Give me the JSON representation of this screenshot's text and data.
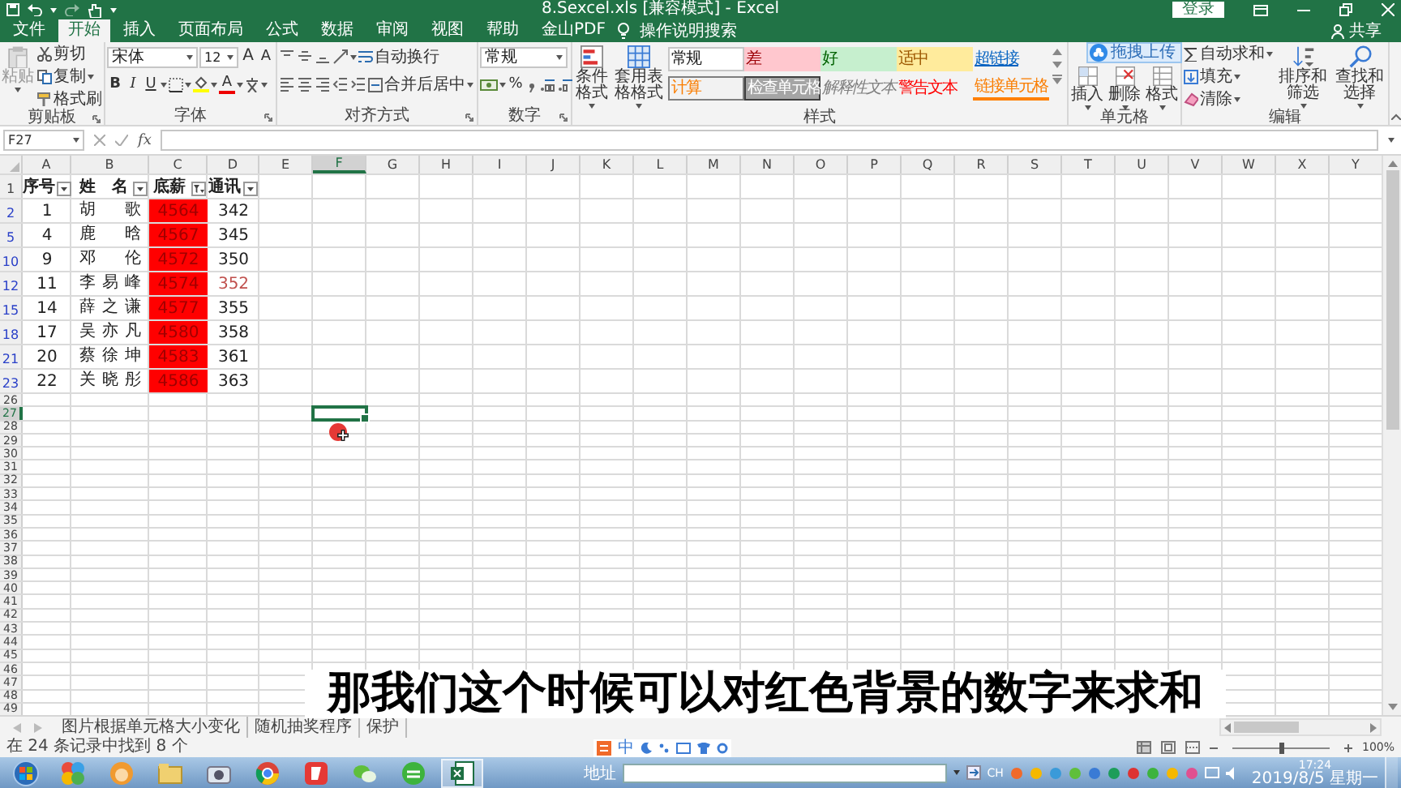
{
  "window": {
    "title": "8.Sexcel.xls [兼容模式] - Excel",
    "sign_in": "登录"
  },
  "menu_tabs": [
    {
      "label": "文件",
      "selected": false
    },
    {
      "label": "开始",
      "selected": true
    },
    {
      "label": "插入",
      "selected": false
    },
    {
      "label": "页面布局",
      "selected": false
    },
    {
      "label": "公式",
      "selected": false
    },
    {
      "label": "数据",
      "selected": false
    },
    {
      "label": "审阅",
      "selected": false
    },
    {
      "label": "视图",
      "selected": false
    },
    {
      "label": "帮助",
      "selected": false
    },
    {
      "label": "金山PDF",
      "selected": false
    }
  ],
  "tell_me": "操作说明搜索",
  "share": "共享",
  "ribbon": [
    {
      "kind": "clipboard",
      "label": "剪贴板",
      "paste": {
        "text": "粘贴",
        "disabled": true
      },
      "commands": [
        "剪切",
        "复制",
        "格式刷"
      ]
    },
    {
      "kind": "font",
      "label": "字体",
      "font": "宋体",
      "size": "12",
      "grow": "A",
      "shrink": "A",
      "styles": [
        "B",
        "I",
        "U"
      ],
      "font_color": "A"
    },
    {
      "kind": "alignment",
      "label": "对齐方式",
      "wrap": "自动换行",
      "merge": "合并后居中"
    },
    {
      "kind": "number",
      "label": "数字",
      "format": "常规",
      "percent": "%"
    },
    {
      "kind": "styles",
      "label": "样式",
      "conditional": "条件格式",
      "table": "套用表格格式",
      "cells": [
        {
          "kind": "normal",
          "text": "常规"
        },
        {
          "kind": "bad",
          "text": "差"
        },
        {
          "kind": "good",
          "text": "好"
        },
        {
          "kind": "neutral",
          "text": "适中"
        },
        {
          "kind": "hyperlink",
          "text": "超链接"
        },
        {
          "kind": "calculation",
          "text": "计算"
        },
        {
          "kind": "check",
          "text": "检查单元格"
        },
        {
          "kind": "explanatory",
          "text": "解释性文本"
        },
        {
          "kind": "warning",
          "text": "警告文本"
        },
        {
          "kind": "linked",
          "text": "链接单元格"
        }
      ]
    },
    {
      "kind": "cells",
      "label": "单元格",
      "commands": [
        "插入",
        "删除",
        "格式"
      ]
    },
    {
      "kind": "editing",
      "label": "编辑",
      "commands": [
        "自动求和",
        "填充",
        "清除"
      ],
      "sort": "排序和筛选",
      "find": "查找和选择"
    }
  ],
  "upload_badge": "拖拽上传",
  "formula_bar": {
    "name_box": "F27",
    "function_label": "fx"
  },
  "sheet": {
    "columns": [
      {
        "letter": "A",
        "selected": false
      },
      {
        "letter": "B",
        "selected": false
      },
      {
        "letter": "C",
        "selected": false
      },
      {
        "letter": "D",
        "selected": false
      },
      {
        "letter": "E",
        "selected": false
      },
      {
        "letter": "F",
        "selected": true
      },
      {
        "letter": "G",
        "selected": false
      },
      {
        "letter": "H",
        "selected": false
      },
      {
        "letter": "I",
        "selected": false
      },
      {
        "letter": "J",
        "selected": false
      },
      {
        "letter": "K",
        "selected": false
      },
      {
        "letter": "L",
        "selected": false
      },
      {
        "letter": "M",
        "selected": false
      },
      {
        "letter": "N",
        "selected": false
      },
      {
        "letter": "O",
        "selected": false
      },
      {
        "letter": "P",
        "selected": false
      },
      {
        "letter": "Q",
        "selected": false
      },
      {
        "letter": "R",
        "selected": false
      },
      {
        "letter": "S",
        "selected": false
      },
      {
        "letter": "T",
        "selected": false
      },
      {
        "letter": "U",
        "selected": false
      },
      {
        "letter": "V",
        "selected": false
      },
      {
        "letter": "W",
        "selected": false
      },
      {
        "letter": "X",
        "selected": false
      },
      {
        "letter": "Y",
        "selected": false
      }
    ],
    "rows": [
      {
        "label": "1",
        "filtered": false,
        "selected": false,
        "cells": [
          {
            "text": "序号",
            "kind": "header",
            "filter_active": false
          },
          {
            "text": "姓名",
            "kind": "header_name",
            "filter_active": false
          },
          {
            "text": "底薪",
            "kind": "header",
            "filter_active": true
          },
          {
            "text": "通讯",
            "kind": "header",
            "filter_active": false
          }
        ]
      },
      {
        "label": "2",
        "filtered": true,
        "selected": false,
        "cells": [
          {
            "text": "1",
            "kind": "number"
          },
          {
            "text": "胡歌",
            "kind": "name"
          },
          {
            "text": "4564",
            "kind": "number",
            "color": "#ff0000"
          },
          {
            "text": "342",
            "kind": "number"
          }
        ]
      },
      {
        "label": "5",
        "filtered": true,
        "selected": false,
        "cells": [
          {
            "text": "4",
            "kind": "number"
          },
          {
            "text": "鹿晗",
            "kind": "name"
          },
          {
            "text": "4567",
            "kind": "number",
            "color": "#ff0000"
          },
          {
            "text": "345",
            "kind": "number"
          }
        ]
      },
      {
        "label": "10",
        "filtered": true,
        "selected": false,
        "cells": [
          {
            "text": "9",
            "kind": "number"
          },
          {
            "text": "邓伦",
            "kind": "name"
          },
          {
            "text": "4572",
            "kind": "number",
            "color": "#ff0000"
          },
          {
            "text": "350",
            "kind": "number"
          }
        ]
      },
      {
        "label": "12",
        "filtered": true,
        "selected": false,
        "cells": [
          {
            "text": "11",
            "kind": "number"
          },
          {
            "text": "李易峰",
            "kind": "name"
          },
          {
            "text": "4574",
            "kind": "number",
            "color": "#ff0000"
          },
          {
            "text": "352",
            "kind": "flagged_number"
          }
        ]
      },
      {
        "label": "15",
        "filtered": true,
        "selected": false,
        "cells": [
          {
            "text": "14",
            "kind": "number"
          },
          {
            "text": "薛之谦",
            "kind": "name"
          },
          {
            "text": "4577",
            "kind": "number",
            "color": "#ff0000"
          },
          {
            "text": "355",
            "kind": "number"
          }
        ]
      },
      {
        "label": "18",
        "filtered": true,
        "selected": false,
        "cells": [
          {
            "text": "17",
            "kind": "number"
          },
          {
            "text": "吴亦凡",
            "kind": "name"
          },
          {
            "text": "4580",
            "kind": "number",
            "color": "#ff0000"
          },
          {
            "text": "358",
            "kind": "number"
          }
        ]
      },
      {
        "label": "21",
        "filtered": true,
        "selected": false,
        "cells": [
          {
            "text": "20",
            "kind": "number"
          },
          {
            "text": "蔡徐坤",
            "kind": "name"
          },
          {
            "text": "4583",
            "kind": "number",
            "color": "#ff0000"
          },
          {
            "text": "361",
            "kind": "number"
          }
        ]
      },
      {
        "label": "23",
        "filtered": true,
        "selected": false,
        "cells": [
          {
            "text": "22",
            "kind": "number"
          },
          {
            "text": "关晓彤",
            "kind": "name"
          },
          {
            "text": "4586",
            "kind": "number",
            "color": "#ff0000"
          },
          {
            "text": "363",
            "kind": "number"
          }
        ]
      },
      {
        "label": "26",
        "filtered": false,
        "selected": false
      },
      {
        "label": "27",
        "filtered": false,
        "selected": true
      },
      {
        "label": "28",
        "filtered": false,
        "selected": false
      },
      {
        "label": "29",
        "filtered": false,
        "selected": false
      },
      {
        "label": "30",
        "filtered": false,
        "selected": false
      },
      {
        "label": "31",
        "filtered": false,
        "selected": false
      },
      {
        "label": "32",
        "filtered": false,
        "selected": false
      },
      {
        "label": "33",
        "filtered": false,
        "selected": false
      },
      {
        "label": "34",
        "filtered": false,
        "selected": false
      },
      {
        "label": "35",
        "filtered": false,
        "selected": false
      },
      {
        "label": "36",
        "filtered": false,
        "selected": false
      },
      {
        "label": "37",
        "filtered": false,
        "selected": false
      },
      {
        "label": "38",
        "filtered": false,
        "selected": false
      },
      {
        "label": "39",
        "filtered": false,
        "selected": false
      },
      {
        "label": "40",
        "filtered": false,
        "selected": false
      },
      {
        "label": "41",
        "filtered": false,
        "selected": false
      },
      {
        "label": "42",
        "filtered": false,
        "selected": false
      },
      {
        "label": "43",
        "filtered": false,
        "selected": false
      },
      {
        "label": "44",
        "filtered": false,
        "selected": false
      },
      {
        "label": "45",
        "filtered": false,
        "selected": false
      },
      {
        "label": "46",
        "filtered": false,
        "selected": false
      },
      {
        "label": "47",
        "filtered": false,
        "selected": false
      },
      {
        "label": "48",
        "filtered": false,
        "selected": false
      },
      {
        "label": "49",
        "filtered": false,
        "selected": false
      }
    ]
  },
  "sheet_tabs": [
    {
      "label": "图片根据单元格大小变化",
      "selected": false
    },
    {
      "label": "随机抽奖程序",
      "selected": false
    },
    {
      "label": "保护",
      "selected": false
    }
  ],
  "caption": "那我们这个时候可以对红色背景的数字来求和",
  "status_bar": {
    "message": "在 24 条记录中找到 8 个",
    "ime": "中",
    "zoom": {
      "text": "100%",
      "level": 0.5
    }
  },
  "taskbar": {
    "address_label": "地址",
    "language": "CH",
    "time": "17:24",
    "date": "2019/8/5 星期一"
  }
}
